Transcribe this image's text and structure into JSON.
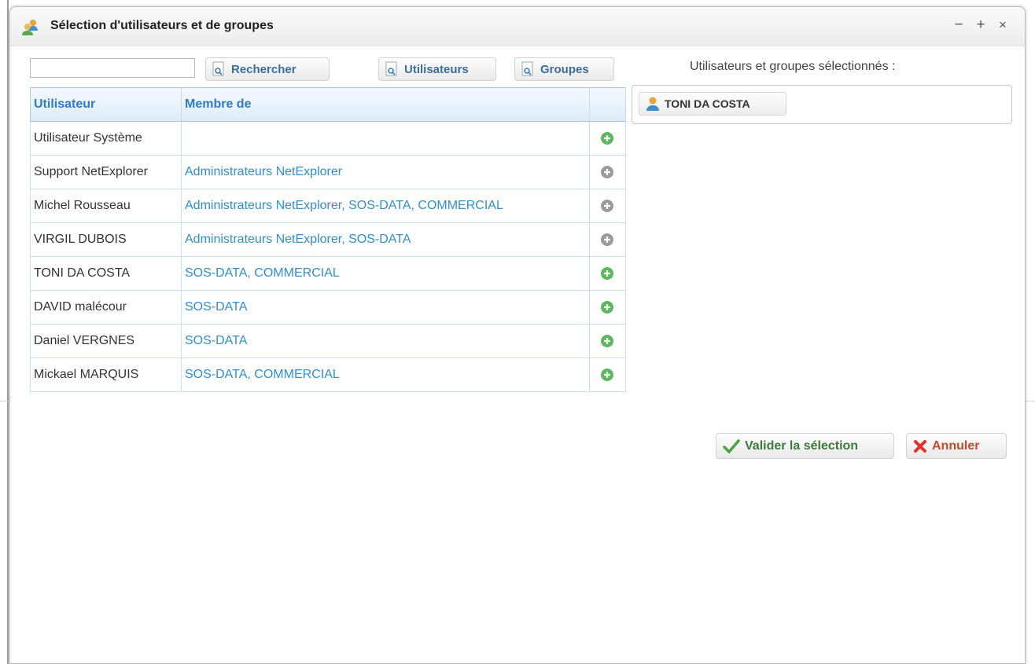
{
  "window": {
    "title": "Sélection d'utilisateurs et de groupes",
    "controls": {
      "minimize": "−",
      "maximize": "+",
      "close": "×"
    }
  },
  "toolbar": {
    "search_value": "",
    "search_label": "Rechercher",
    "users_label": "Utilisateurs",
    "groups_label": "Groupes"
  },
  "selection": {
    "label": "Utilisateurs et groupes sélectionnés :",
    "items": [
      {
        "name": "TONI DA COSTA",
        "icon": "user-icon"
      }
    ]
  },
  "grid": {
    "columns": [
      "Utilisateur",
      "Membre de",
      ""
    ],
    "rows": [
      {
        "user": "Utilisateur Système",
        "member": "",
        "action": "add-green"
      },
      {
        "user": "Support NetExplorer",
        "member": "Administrateurs NetExplorer",
        "action": "add-gray"
      },
      {
        "user": "Michel Rousseau",
        "member": "Administrateurs NetExplorer, SOS-DATA, COMMERCIAL",
        "action": "add-gray"
      },
      {
        "user": "VIRGIL DUBOIS",
        "member": "Administrateurs NetExplorer, SOS-DATA",
        "action": "add-gray"
      },
      {
        "user": "TONI DA COSTA",
        "member": "SOS-DATA, COMMERCIAL",
        "action": "add-green"
      },
      {
        "user": "DAVID malécour",
        "member": "SOS-DATA",
        "action": "add-green"
      },
      {
        "user": "Daniel VERGNES",
        "member": "SOS-DATA",
        "action": "add-green"
      },
      {
        "user": "Mickael MARQUIS",
        "member": "SOS-DATA, COMMERCIAL",
        "action": "add-green"
      }
    ]
  },
  "footer": {
    "validate_label": "Valider la sélection",
    "cancel_label": "Annuler"
  },
  "colors": {
    "accent": "#2f7cc0",
    "link": "#2f8fce",
    "add_active": "#5cb85c",
    "add_inactive": "#9a9a9a",
    "validate_text": "#3a7a3a",
    "cancel_text": "#c84a2e"
  }
}
